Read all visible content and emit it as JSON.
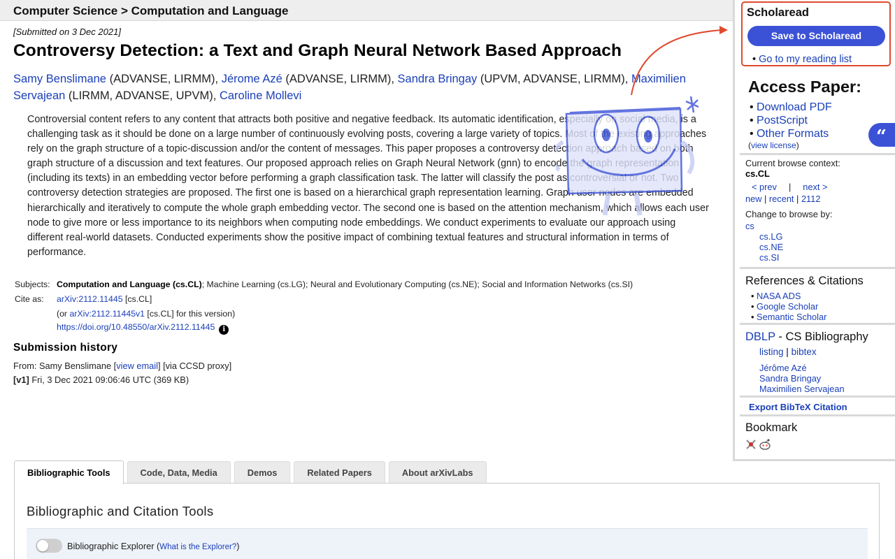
{
  "breadcrumb": "Computer Science > Computation and Language",
  "submitted": "[Submitted on 3 Dec 2021]",
  "title": "Controversy Detection: a Text and Graph Neural Network Based Approach",
  "authors": [
    {
      "name": "Samy Benslimane",
      "aff": " (ADVANSE, LIRMM), "
    },
    {
      "name": "Jérome Azé",
      "aff": " (ADVANSE, LIRMM), "
    },
    {
      "name": "Sandra Bringay",
      "aff": " (UPVM, ADVANSE, LIRMM), "
    },
    {
      "name": "Maximilien Servajean",
      "aff": " (LIRMM, ADVANSE, UPVM), "
    },
    {
      "name": "Caroline Mollevi",
      "aff": ""
    }
  ],
  "abstract": "Controversial content refers to any content that attracts both positive and negative feedback. Its automatic identification, especially on social media, is a challenging task as it should be done on a large number of continuously evolving posts, covering a large variety of topics. Most of the existing approaches rely on the graph structure of a topic-discussion and/or the content of messages. This paper proposes a controversy detection approach based on both graph structure of a discussion and text features. Our proposed approach relies on Graph Neural Network (gnn) to encode the graph representation (including its texts) in an embedding vector before performing a graph classification task. The latter will classify the post as controversial or not. Two controversy detection strategies are proposed. The first one is based on a hierarchical graph representation learning. Graph user nodes are embedded hierarchically and iteratively to compute the whole graph embedding vector. The second one is based on the attention mechanism, which allows each user node to give more or less importance to its neighbors when computing node embeddings. We conduct experiments to evaluate our approach using different real-world datasets. Conducted experiments show the positive impact of combining textual features and structural information in terms of performance.",
  "meta": {
    "subjects_label": "Subjects:",
    "subjects_primary": "Computation and Language (cs.CL)",
    "subjects_rest": "; Machine Learning (cs.LG); Neural and Evolutionary Computing (cs.NE); Social and Information Networks (cs.SI)",
    "cite_label": "Cite as:",
    "cite_id": "arXiv:2112.11445",
    "cite_suffix": " [cs.CL]",
    "version_prefix": "(or ",
    "version_id": "arXiv:2112.11445v1",
    "version_suffix": " [cs.CL] for this version)",
    "doi": "https://doi.org/10.48550/arXiv.2112.11445"
  },
  "history": {
    "heading": "Submission history",
    "from_prefix": "From: Samy Benslimane [",
    "view_email": "view email",
    "from_suffix": "] [via CCSD proxy]",
    "v1_label": "[v1]",
    "v1_text": " Fri, 3 Dec 2021 09:06:46 UTC (369 KB)"
  },
  "tabs": [
    "Bibliographic Tools",
    "Code, Data, Media",
    "Demos",
    "Related Papers",
    "About arXivLabs"
  ],
  "panel": {
    "title": "Bibliographic and Citation Tools",
    "explorer_label": "Bibliographic Explorer (",
    "explorer_link": "What is the Explorer?",
    "explorer_close": ")"
  },
  "scholaread": {
    "title": "Scholaread",
    "save_button": "Save to Scholaread",
    "reading_list": "Go to my reading list",
    "accent": "#e04a2f",
    "button_color": "#3c52d6"
  },
  "access": {
    "heading": "Access Paper:",
    "links": [
      "Download PDF",
      "PostScript",
      "Other Formats"
    ],
    "license_prefix": "(",
    "license_link": "view license",
    "license_suffix": ")"
  },
  "browse": {
    "context_label": "Current browse context:",
    "context": "cs.CL",
    "prev": "< prev",
    "sep": "|",
    "next": "next >",
    "new": "new",
    "recent": "recent",
    "month": "2112",
    "change_label": "Change to browse by:",
    "cats": [
      "cs",
      "cs.LG",
      "cs.NE",
      "cs.SI"
    ]
  },
  "refs": {
    "heading": "References & Citations",
    "links": [
      "NASA ADS",
      "Google Scholar",
      "Semantic Scholar"
    ]
  },
  "dblp": {
    "link": "DBLP",
    "heading_rest": " - CS Bibliography",
    "listing": "listing",
    "bar": "|",
    "bibtex": "bibtex",
    "authors": [
      "Jérôme Azé",
      "Sandra Bringay",
      "Maximilien Servajean"
    ]
  },
  "export_bibtex": "Export BibTeX Citation",
  "bookmark": {
    "heading": "Bookmark",
    "icons": [
      "science-wise-icon",
      "reddit-icon"
    ]
  },
  "quote_tab": "“"
}
